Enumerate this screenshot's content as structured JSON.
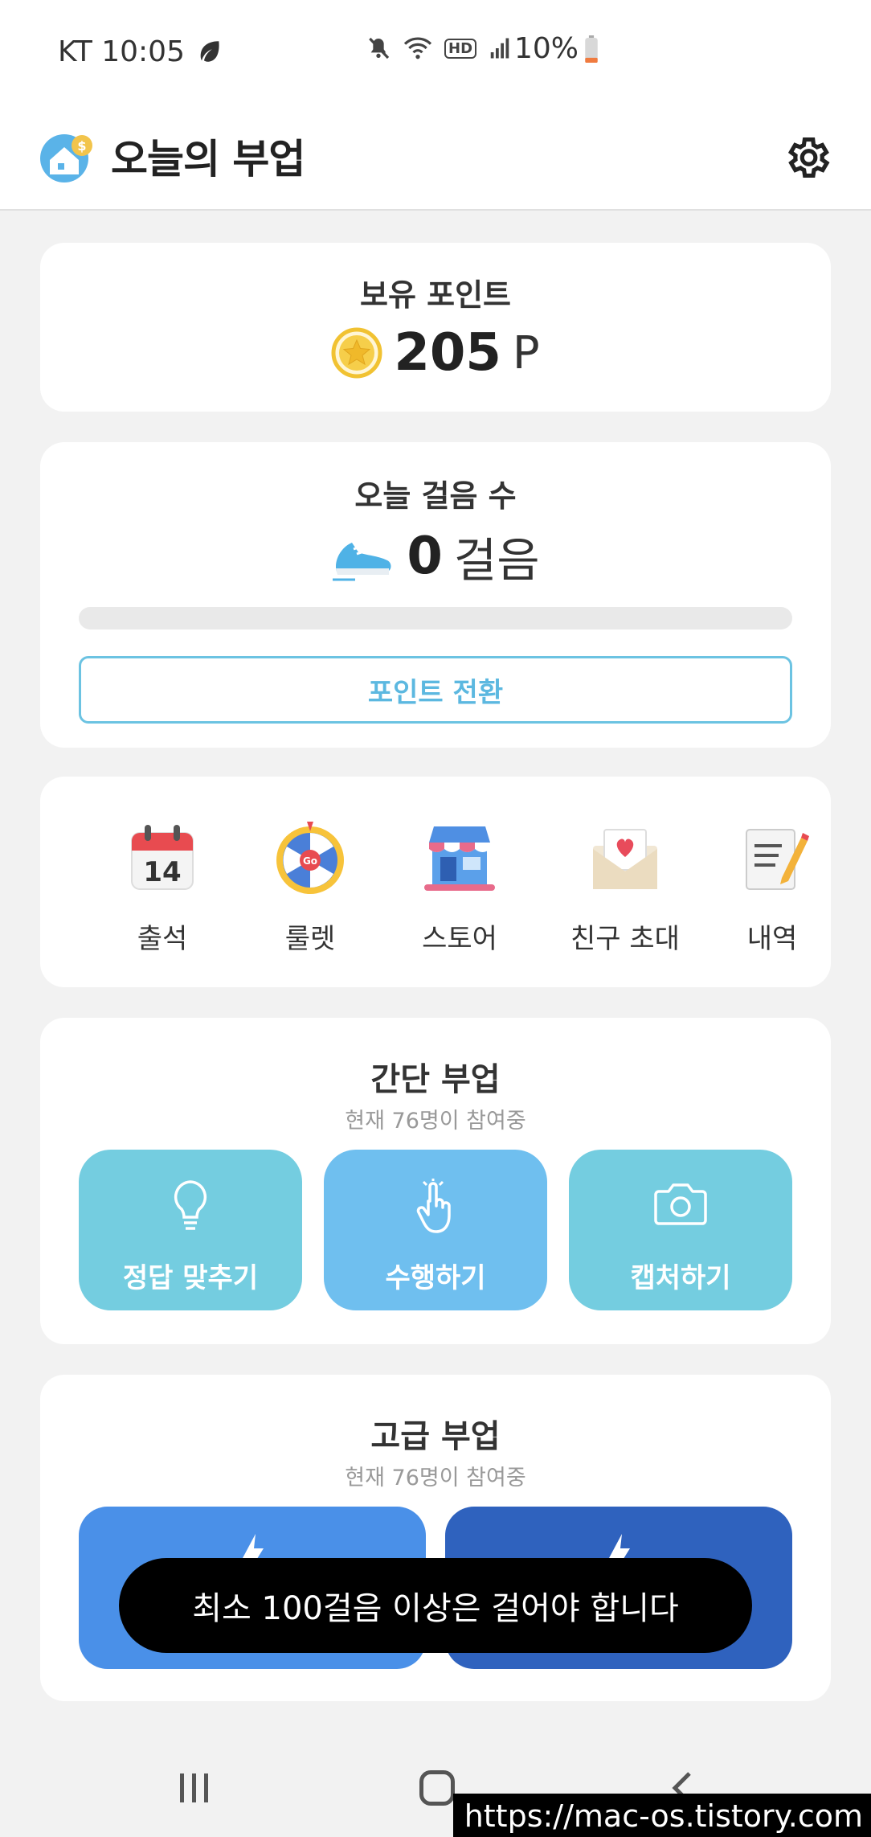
{
  "status_bar": {
    "carrier_time": "KT 10:05",
    "network_badge": "HD",
    "battery": "10%",
    "icons": [
      "leaf-icon",
      "mute-icon",
      "wifi-icon",
      "hd-voice-icon",
      "signal-icon",
      "battery-icon"
    ]
  },
  "header": {
    "title": "오늘의 부업",
    "icons": [
      "app-logo-icon",
      "gear-icon"
    ]
  },
  "points": {
    "title": "보유 포인트",
    "value": "205",
    "unit": "P"
  },
  "steps": {
    "title": "오늘 걸음 수",
    "value": "0",
    "unit": "걸음",
    "progress": 0,
    "convert_label": "포인트 전환"
  },
  "menu": {
    "items": [
      {
        "label": "출석",
        "icon": "calendar-icon"
      },
      {
        "label": "룰렛",
        "icon": "roulette-icon"
      },
      {
        "label": "스토어",
        "icon": "store-icon"
      },
      {
        "label": "친구 초대",
        "icon": "invite-letter-icon"
      },
      {
        "label": "내역",
        "icon": "notepad-icon"
      }
    ]
  },
  "simple_tasks": {
    "title": "간단 부업",
    "subtitle": "현재 76명이 참여중",
    "buttons": [
      {
        "label": "정답 맞추기",
        "icon": "lightbulb-icon",
        "color": "#74cde0"
      },
      {
        "label": "수행하기",
        "icon": "tap-hand-icon",
        "color": "#6fbfef"
      },
      {
        "label": "캡처하기",
        "icon": "camera-icon",
        "color": "#74cde0"
      }
    ]
  },
  "advanced_tasks": {
    "title": "고급 부업",
    "subtitle": "현재 76명이 참여중",
    "buttons": [
      {
        "icon": "lightning-icon",
        "color": "#4a90e8"
      },
      {
        "icon": "lightning-icon",
        "color": "#2f62be"
      }
    ]
  },
  "toast": {
    "message": "최소 100걸음 이상은 걸어야 합니다"
  },
  "nav": {
    "icons": [
      "recent-apps-icon",
      "home-icon",
      "back-icon"
    ]
  },
  "watermark": "https://mac-os.tistory.com"
}
